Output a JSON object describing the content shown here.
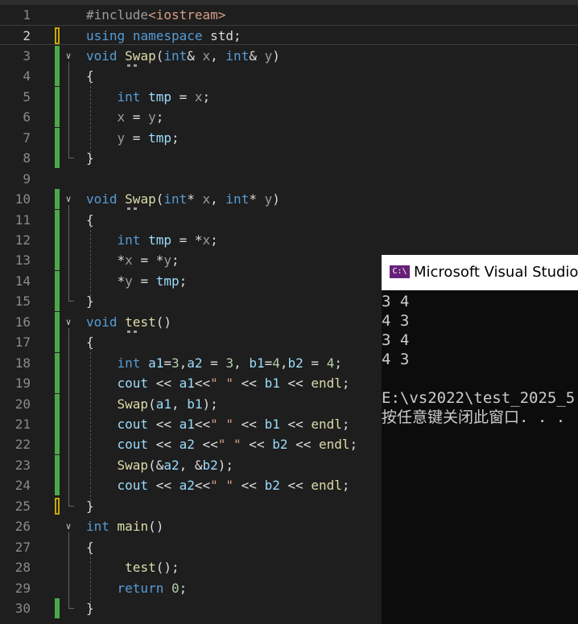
{
  "editor": {
    "lines": [
      {
        "n": "1",
        "segs": [
          {
            "t": "#include",
            "c": "pr"
          },
          {
            "t": "<iostream>",
            "c": "st"
          }
        ]
      },
      {
        "n": "2",
        "segs": [
          {
            "t": "using",
            "c": "kw"
          },
          {
            "t": " "
          },
          {
            "t": "namespace",
            "c": "kw"
          },
          {
            "t": " std;"
          }
        ]
      },
      {
        "n": "3",
        "segs": [
          {
            "t": "void",
            "c": "kw"
          },
          {
            "t": " "
          },
          {
            "t": "Swap",
            "c": "fn"
          },
          {
            "t": "("
          },
          {
            "t": "int",
            "c": "kw"
          },
          {
            "t": "& "
          },
          {
            "t": "x",
            "c": "pp"
          },
          {
            "t": ", "
          },
          {
            "t": "int",
            "c": "kw"
          },
          {
            "t": "& "
          },
          {
            "t": "y",
            "c": "pp"
          },
          {
            "t": ")"
          }
        ]
      },
      {
        "n": "4",
        "segs": [
          {
            "t": "{"
          }
        ]
      },
      {
        "n": "5",
        "segs": [
          {
            "t": "    "
          },
          {
            "t": "int",
            "c": "kw"
          },
          {
            "t": " "
          },
          {
            "t": "tmp",
            "c": "vr"
          },
          {
            "t": " = "
          },
          {
            "t": "x",
            "c": "pp"
          },
          {
            "t": ";"
          }
        ]
      },
      {
        "n": "6",
        "segs": [
          {
            "t": "    "
          },
          {
            "t": "x",
            "c": "pp"
          },
          {
            "t": " = "
          },
          {
            "t": "y",
            "c": "pp"
          },
          {
            "t": ";"
          }
        ]
      },
      {
        "n": "7",
        "segs": [
          {
            "t": "    "
          },
          {
            "t": "y",
            "c": "pp"
          },
          {
            "t": " = "
          },
          {
            "t": "tmp",
            "c": "vr"
          },
          {
            "t": ";"
          }
        ]
      },
      {
        "n": "8",
        "segs": [
          {
            "t": "}"
          }
        ]
      },
      {
        "n": "9",
        "segs": []
      },
      {
        "n": "10",
        "segs": [
          {
            "t": "void",
            "c": "kw"
          },
          {
            "t": " "
          },
          {
            "t": "Swap",
            "c": "fn"
          },
          {
            "t": "("
          },
          {
            "t": "int",
            "c": "kw"
          },
          {
            "t": "* "
          },
          {
            "t": "x",
            "c": "pp"
          },
          {
            "t": ", "
          },
          {
            "t": "int",
            "c": "kw"
          },
          {
            "t": "* "
          },
          {
            "t": "y",
            "c": "pp"
          },
          {
            "t": ")"
          }
        ]
      },
      {
        "n": "11",
        "segs": [
          {
            "t": "{"
          }
        ]
      },
      {
        "n": "12",
        "segs": [
          {
            "t": "    "
          },
          {
            "t": "int",
            "c": "kw"
          },
          {
            "t": " "
          },
          {
            "t": "tmp",
            "c": "vr"
          },
          {
            "t": " = *"
          },
          {
            "t": "x",
            "c": "pp"
          },
          {
            "t": ";"
          }
        ]
      },
      {
        "n": "13",
        "segs": [
          {
            "t": "    *"
          },
          {
            "t": "x",
            "c": "pp"
          },
          {
            "t": " = *"
          },
          {
            "t": "y",
            "c": "pp"
          },
          {
            "t": ";"
          }
        ]
      },
      {
        "n": "14",
        "segs": [
          {
            "t": "    *"
          },
          {
            "t": "y",
            "c": "pp"
          },
          {
            "t": " = "
          },
          {
            "t": "tmp",
            "c": "vr"
          },
          {
            "t": ";"
          }
        ]
      },
      {
        "n": "15",
        "segs": [
          {
            "t": "}"
          }
        ]
      },
      {
        "n": "16",
        "segs": [
          {
            "t": "void",
            "c": "kw"
          },
          {
            "t": " "
          },
          {
            "t": "test",
            "c": "fn"
          },
          {
            "t": "()"
          }
        ]
      },
      {
        "n": "17",
        "segs": [
          {
            "t": "{"
          }
        ]
      },
      {
        "n": "18",
        "segs": [
          {
            "t": "    "
          },
          {
            "t": "int",
            "c": "kw"
          },
          {
            "t": " "
          },
          {
            "t": "a1",
            "c": "vr"
          },
          {
            "t": "="
          },
          {
            "t": "3",
            "c": "nm"
          },
          {
            "t": ","
          },
          {
            "t": "a2",
            "c": "vr"
          },
          {
            "t": " = "
          },
          {
            "t": "3",
            "c": "nm"
          },
          {
            "t": ", "
          },
          {
            "t": "b1",
            "c": "vr"
          },
          {
            "t": "="
          },
          {
            "t": "4",
            "c": "nm"
          },
          {
            "t": ","
          },
          {
            "t": "b2",
            "c": "vr"
          },
          {
            "t": " = "
          },
          {
            "t": "4",
            "c": "nm"
          },
          {
            "t": ";"
          }
        ]
      },
      {
        "n": "19",
        "segs": [
          {
            "t": "    "
          },
          {
            "t": "cout",
            "c": "vr"
          },
          {
            "t": " << "
          },
          {
            "t": "a1",
            "c": "vr"
          },
          {
            "t": "<<"
          },
          {
            "t": "\" \"",
            "c": "st"
          },
          {
            "t": " << "
          },
          {
            "t": "b1",
            "c": "vr"
          },
          {
            "t": " << "
          },
          {
            "t": "endl",
            "c": "fn"
          },
          {
            "t": ";"
          }
        ]
      },
      {
        "n": "20",
        "segs": [
          {
            "t": "    "
          },
          {
            "t": "Swap",
            "c": "fn"
          },
          {
            "t": "("
          },
          {
            "t": "a1",
            "c": "vr"
          },
          {
            "t": ", "
          },
          {
            "t": "b1",
            "c": "vr"
          },
          {
            "t": ");"
          }
        ]
      },
      {
        "n": "21",
        "segs": [
          {
            "t": "    "
          },
          {
            "t": "cout",
            "c": "vr"
          },
          {
            "t": " << "
          },
          {
            "t": "a1",
            "c": "vr"
          },
          {
            "t": "<<"
          },
          {
            "t": "\" \"",
            "c": "st"
          },
          {
            "t": " << "
          },
          {
            "t": "b1",
            "c": "vr"
          },
          {
            "t": " << "
          },
          {
            "t": "endl",
            "c": "fn"
          },
          {
            "t": ";"
          }
        ]
      },
      {
        "n": "22",
        "segs": [
          {
            "t": "    "
          },
          {
            "t": "cout",
            "c": "vr"
          },
          {
            "t": " << "
          },
          {
            "t": "a2",
            "c": "vr"
          },
          {
            "t": " <<"
          },
          {
            "t": "\" \"",
            "c": "st"
          },
          {
            "t": " << "
          },
          {
            "t": "b2",
            "c": "vr"
          },
          {
            "t": " << "
          },
          {
            "t": "endl",
            "c": "fn"
          },
          {
            "t": ";"
          }
        ]
      },
      {
        "n": "23",
        "segs": [
          {
            "t": "    "
          },
          {
            "t": "Swap",
            "c": "fn"
          },
          {
            "t": "(&"
          },
          {
            "t": "a2",
            "c": "vr"
          },
          {
            "t": ", &"
          },
          {
            "t": "b2",
            "c": "vr"
          },
          {
            "t": ");"
          }
        ]
      },
      {
        "n": "24",
        "segs": [
          {
            "t": "    "
          },
          {
            "t": "cout",
            "c": "vr"
          },
          {
            "t": " << "
          },
          {
            "t": "a2",
            "c": "vr"
          },
          {
            "t": "<<"
          },
          {
            "t": "\" \"",
            "c": "st"
          },
          {
            "t": " << "
          },
          {
            "t": "b2",
            "c": "vr"
          },
          {
            "t": " << "
          },
          {
            "t": "endl",
            "c": "fn"
          },
          {
            "t": ";"
          }
        ]
      },
      {
        "n": "25",
        "segs": [
          {
            "t": "}"
          }
        ]
      },
      {
        "n": "26",
        "segs": [
          {
            "t": "int",
            "c": "kw"
          },
          {
            "t": " "
          },
          {
            "t": "main",
            "c": "fn"
          },
          {
            "t": "()"
          }
        ]
      },
      {
        "n": "27",
        "segs": [
          {
            "t": "{"
          }
        ]
      },
      {
        "n": "28",
        "segs": [
          {
            "t": "     "
          },
          {
            "t": "test",
            "c": "fn"
          },
          {
            "t": "();"
          }
        ]
      },
      {
        "n": "29",
        "segs": [
          {
            "t": "    "
          },
          {
            "t": "return",
            "c": "kw"
          },
          {
            "t": " "
          },
          {
            "t": "0",
            "c": "nm"
          },
          {
            "t": ";"
          }
        ]
      },
      {
        "n": "30",
        "segs": [
          {
            "t": "}"
          }
        ]
      }
    ],
    "current_line": "2",
    "colors": {
      "background": "#1e1e1e",
      "keyword": "#569cd6",
      "function": "#dcdcaa",
      "variable": "#9cdcfe",
      "string": "#d69d85",
      "number": "#b5cea8",
      "parameter": "#9b9b9b",
      "change_saved": "#4aa84a",
      "change_unsaved": "#c7a600"
    }
  },
  "console": {
    "title": "Microsoft Visual Studio",
    "icon_label": "C:\\",
    "icon": "visual-studio-console-icon",
    "output": [
      "3 4",
      "4 3",
      "3 4",
      "4 3",
      "",
      "E:\\vs2022\\test_2025_5",
      "按任意键关闭此窗口. . ."
    ]
  }
}
